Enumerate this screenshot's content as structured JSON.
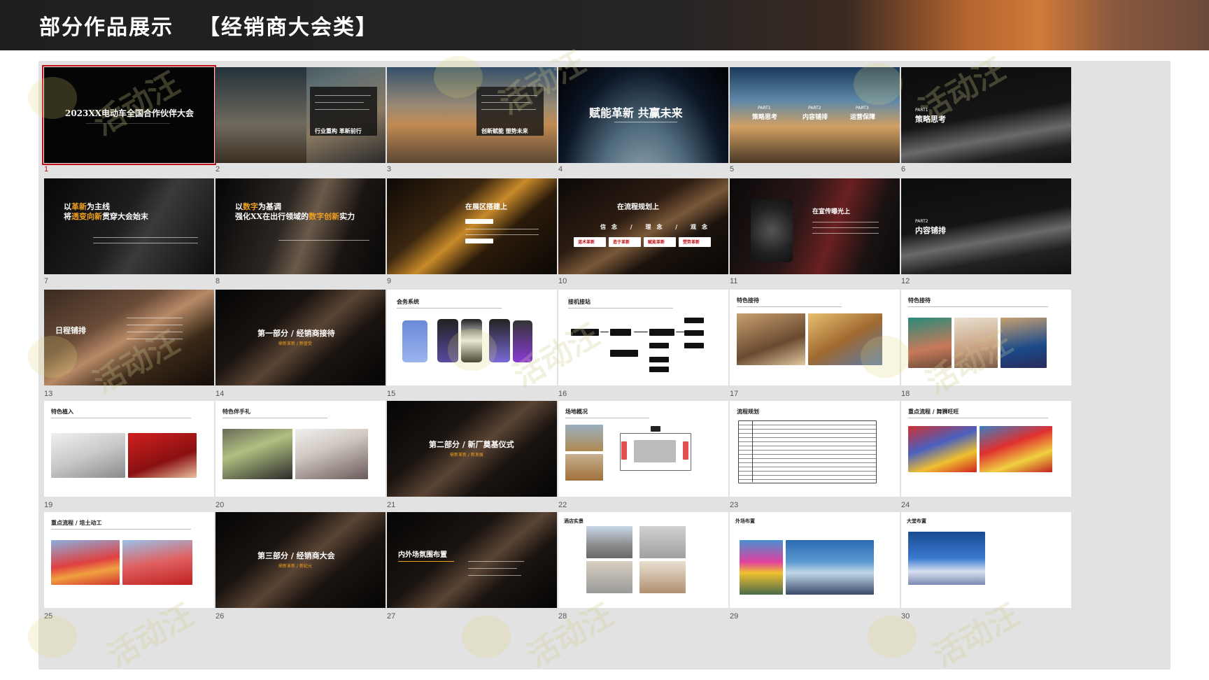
{
  "header": {
    "title": "部分作品展示",
    "subtitle": "【经销商大会类】"
  },
  "watermark": "活动汪",
  "slides": [
    {
      "num": "1",
      "title": "2023XX电动车全国合作伙伴大会",
      "selected": true
    },
    {
      "num": "2",
      "title": "行业重构 革新前行"
    },
    {
      "num": "3",
      "title": "创新赋能 塑势未来"
    },
    {
      "num": "4",
      "title": "赋能革新 共赢未来"
    },
    {
      "num": "5",
      "part1": "PART1",
      "p1": "策略思考",
      "part2": "PART2",
      "p2": "内容铺排",
      "part3": "PART3",
      "p3": "运营保障"
    },
    {
      "num": "6",
      "part": "PART1",
      "title": "策略思考"
    },
    {
      "num": "7",
      "line1a": "以",
      "line1b": "革新",
      "line1c": "为主线",
      "line2a": "将",
      "line2b": "透变向新",
      "line2c": "贯穿大会始末"
    },
    {
      "num": "8",
      "line1a": "以",
      "line1b": "数字",
      "line1c": "为基调",
      "line2a": "强化XX在出行领域的",
      "line2b": "数字创新",
      "line2c": "实力"
    },
    {
      "num": "9",
      "title": "在展区搭建上"
    },
    {
      "num": "10",
      "title": "在流程规划上",
      "sub": "信念 / 理念 / 观念",
      "tags": [
        "道术革新",
        "造于革新",
        "赋能革新",
        "塑势革新"
      ]
    },
    {
      "num": "11",
      "title": "在宣传曝光上"
    },
    {
      "num": "12",
      "part": "PART2",
      "title": "内容铺排"
    },
    {
      "num": "13",
      "title": "日程铺排"
    },
    {
      "num": "14",
      "title": "第一部分 / 经销商接待",
      "sub": "鼎新革新 / 新盛受"
    },
    {
      "num": "15",
      "title": "会务系统"
    },
    {
      "num": "16",
      "title": "接机接站"
    },
    {
      "num": "17",
      "title": "特色接待"
    },
    {
      "num": "18",
      "title": "特色接待"
    },
    {
      "num": "19",
      "title": "特色植入"
    },
    {
      "num": "20",
      "title": "特色伴手礼"
    },
    {
      "num": "21",
      "title": "第二部分 / 新厂奠基仪式",
      "sub": "鼎新革新 / 新发展"
    },
    {
      "num": "22",
      "title": "场地概况"
    },
    {
      "num": "23",
      "title": "流程规划"
    },
    {
      "num": "24",
      "title": "重点流程 / 舞狮旺旺"
    },
    {
      "num": "25",
      "title": "重点流程 / 培土动工"
    },
    {
      "num": "26",
      "title": "第三部分 / 经销商大会",
      "sub": "鼎新革新 / 新纪元"
    },
    {
      "num": "27",
      "title": "内外场氛围布置"
    },
    {
      "num": "28",
      "title": "酒店实景"
    },
    {
      "num": "29",
      "title": "外场布置"
    },
    {
      "num": "30",
      "title": "大堂布置"
    }
  ],
  "colors": {
    "accent_red": "#c0121a",
    "highlight_gold": "#f0a020",
    "panel_bg": "#e2e2e2"
  }
}
